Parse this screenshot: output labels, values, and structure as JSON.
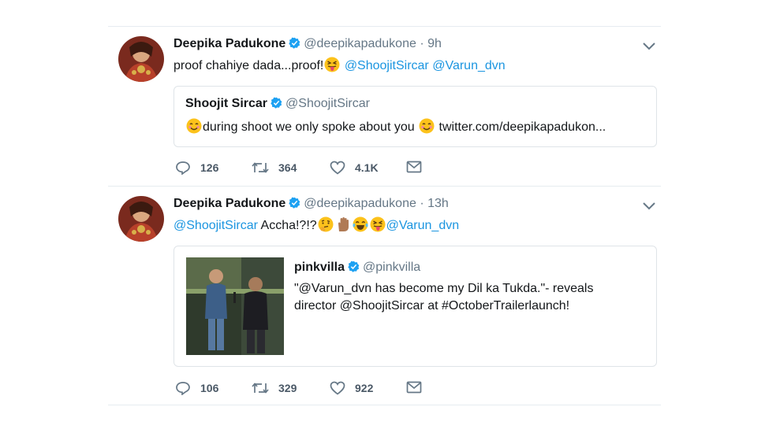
{
  "tweets": [
    {
      "author": "Deepika Padukone",
      "handle": "@deepikapadukone",
      "separator": "·",
      "time": "9h",
      "text_before": "proof chahiye dada...proof!",
      "mention_1": "@ShoojitSircar",
      "mention_2": "@Varun_dvn",
      "quote": {
        "author": "Shoojit Sircar",
        "handle": "@ShoojitSircar",
        "text": "during shoot we only spoke about you",
        "link": "twitter.com/deepikapadukon..."
      },
      "replies": "126",
      "retweets": "364",
      "likes": "4.1K"
    },
    {
      "author": "Deepika Padukone",
      "handle": "@deepikapadukone",
      "separator": "·",
      "time": "13h",
      "mention_1": "@ShoojitSircar",
      "text_middle": "Accha!?!?",
      "mention_2": "@Varun_dvn",
      "quote": {
        "author": "pinkvilla",
        "handle": "@pinkvilla",
        "line_1": "\"@Varun_dvn has become my Dil ka Tukda.\"- reveals",
        "line_2": "director @ShoojitSircar at #OctoberTrailerlaunch!"
      },
      "replies": "106",
      "retweets": "329",
      "likes": "922"
    }
  ],
  "icons": {
    "verified": "verified-badge-icon",
    "chevron": "chevron-down-icon",
    "reply": "reply-icon",
    "retweet": "retweet-icon",
    "like": "heart-icon",
    "dm": "envelope-icon"
  },
  "colors": {
    "link": "#1b95e0",
    "muted": "#657786",
    "verified": "#1da1f2",
    "border": "#e6ecf0"
  }
}
